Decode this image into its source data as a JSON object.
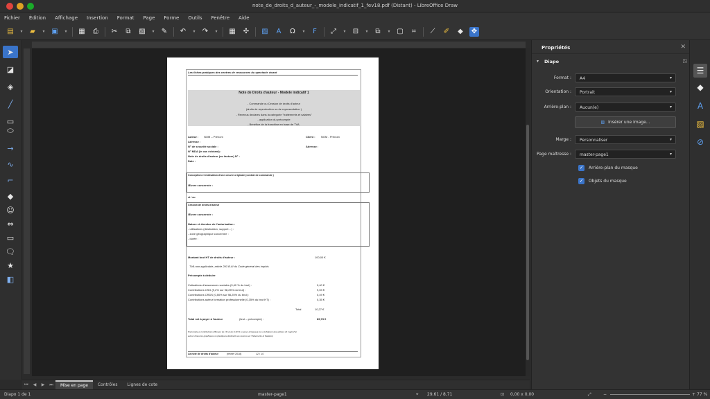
{
  "window": {
    "title": "note_de_droits_d_auteur_-_modele_indicatif_1_fev18.pdf (Distant) - LibreOffice Draw"
  },
  "menu": [
    "Fichier",
    "Édition",
    "Affichage",
    "Insertion",
    "Format",
    "Page",
    "Forme",
    "Outils",
    "Fenêtre",
    "Aide"
  ],
  "document": {
    "header": "Les fiches pratiques des centres de ressources du spectacle vivant",
    "title": "Note de Droits d'auteur - Modele indicatif 1",
    "bullets": [
      "-   Commande ou Cession de droits d'auteur",
      "(droits de reproduction ou de representation )",
      "-   Revenus declares dans la categorie \"traitements et salaires\"",
      "-   application du précompte",
      "-   Bénéfice de la franchise en base de  TVA."
    ],
    "author_label": "Auteur :",
    "author_value": "NOM – Prénom",
    "client_label": "Client :",
    "client_value": "NOM - Prénom",
    "address_left": "Adresse :",
    "address_right": "Adresse :",
    "secu": "N° de sécurité sociale :",
    "mda": "N° MDA (le cas échéant) :",
    "note_no": "Note de droits d'auteur (ou facture) N° :",
    "date": "Date :",
    "box1_title": "Conception et réalisation d'une oeuvre originale (contrat de commande )",
    "box1_work": "Œuvre concernée :",
    "et_ou": "et / ou",
    "box2_title": "Cession de droits d'auteur",
    "box2_work": "Œuvre concernée :",
    "box2_nature": "Nature et étendue de l'autorisation :",
    "box2_items": [
      "-    utilisations (destination, support…) :",
      "-    zone géographique concernée :",
      "-    durée :"
    ],
    "gross_label": "Montant brut HT de droits d'auteur :",
    "gross_value": "100,00 €",
    "tva_note": "TVA non applicable, article 293 B-III du Code général des impôts",
    "precompte_title": "Précompte à déduire",
    "deductions": [
      {
        "label": "Cotisations d'assurances sociales (0,40 % du brut) :",
        "value": "0,40 €"
      },
      {
        "label": "Contributions CSG (9,2% sur 98,25% du brut) :",
        "value": "9,03 €"
      },
      {
        "label": "Contributions CRDS (0,50% sur 98,25% du brut) :",
        "value": "0,49 €"
      },
      {
        "label": "Contributions auteur formation professionnelle (0,35% du brut HT) :",
        "value": "0,35 €"
      }
    ],
    "total_label": "Total",
    "total_value": "10,27 €",
    "net_label": "Total net à payer à l'auteur",
    "net_suffix": "(brut – précompte) :",
    "net_value": "89,73  €",
    "footnote_1": "Précompte et contributions diffuseur de 1% et de 0,10 % à verser à l'Agessa (ou à la Maison des artistes s'il s'agit d'un",
    "footnote_2": "auteur d'œuvres graphiques ou plastiques déclarant ses revenus en Traitements et Salaires)",
    "footer_title": "La note de droits d'auteur",
    "footer_date": "(février 2018)",
    "footer_page": "12 / 14"
  },
  "tabs": [
    "Mise en page",
    "Contrôles",
    "Lignes de cote"
  ],
  "status": {
    "slide": "Diapo 1 de 1",
    "master": "master-page1",
    "pos": "29,61 / 8,71",
    "size": "0,00 x 0,00",
    "zoom": "77 %"
  },
  "sidebar": {
    "title": "Propriétés",
    "section": "Diapo",
    "format_label": "Format :",
    "format_value": "A4",
    "orientation_label": "Orientation :",
    "orientation_value": "Portrait",
    "background_label": "Arrière-plan :",
    "background_value": "Aucun(e)",
    "insert_image": "Insérer une image...",
    "margin_label": "Marge :",
    "margin_value": "Personnaliser",
    "master_label": "Page maîtresse :",
    "master_value": "master-page1",
    "chk_bg": "Arrière-plan du masque",
    "chk_obj": "Objets du masque"
  }
}
